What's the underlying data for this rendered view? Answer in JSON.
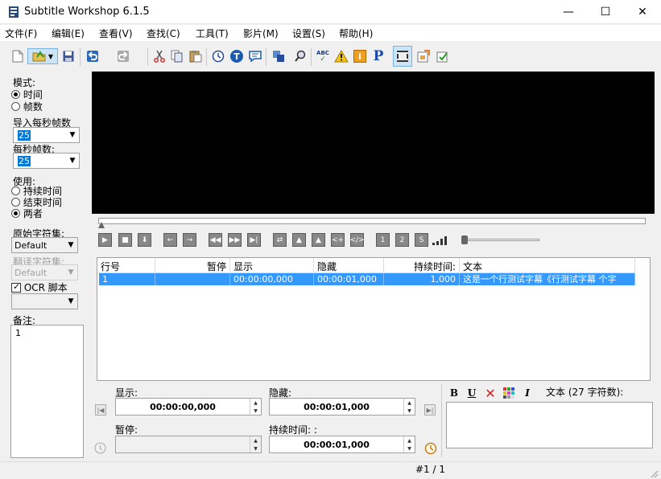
{
  "window": {
    "title": "Subtitle Workshop 6.1.5",
    "minimize": "—",
    "maximize": "☐",
    "close": "✕"
  },
  "menu": [
    "文件(F)",
    "编辑(E)",
    "查看(V)",
    "查找(C)",
    "工具(T)",
    "影片(M)",
    "设置(S)",
    "帮助(H)"
  ],
  "toolbar": {
    "icons": [
      "new-file-icon",
      "open-file-icon",
      "save-icon",
      "undo-icon",
      "redo-icon",
      "cut-icon",
      "copy-icon",
      "paste-icon",
      "timing-icon",
      "text-icon",
      "translation-icon",
      "spellcheck-icon",
      "warning-icon",
      "info-icon",
      "p-icon",
      "video-preview-icon",
      "load-video-icon",
      "check-icon"
    ],
    "text_icon_label": "T",
    "info_icon_label": "i",
    "p_icon_label": "P",
    "spell_label": "ABC"
  },
  "left_panel": {
    "mode_label": "模式:",
    "mode_time": "时间",
    "mode_frames": "帧数",
    "import_fps_label": "导入每秒帧数",
    "import_fps_value": "25",
    "fps_label": "每秒帧数:",
    "fps_value": "25",
    "apply_label": "使用:",
    "apply_duration": "持续时间",
    "apply_end": "结束时间",
    "apply_both": "两者",
    "orig_charset_label": "原始字符集:",
    "orig_charset_value": "Default",
    "trans_charset_label": "翻译字符集:",
    "trans_charset_value": "Default",
    "ocr_label": "OCR 脚本",
    "ocr_value": "",
    "notes_label": "备注:",
    "notes_value": "1"
  },
  "playback": {
    "buttons": [
      "play-icon",
      "stop-icon",
      "pause-icon",
      "back-icon",
      "forward-icon",
      "rewind-icon",
      "fast-forward-icon",
      "frame-icon",
      "loop-icon",
      "set-start-icon",
      "set-end-icon",
      "shift-left-icon",
      "shift-right-icon",
      "one-icon",
      "two-icon",
      "s-icon"
    ],
    "one_label": "1",
    "two_label": "2",
    "s_label": "S"
  },
  "grid": {
    "columns": [
      "行号",
      "暂停",
      "显示",
      "隐藏",
      "持续时间:",
      "文本"
    ],
    "rows": [
      {
        "num": "1",
        "pause": "",
        "show": "00:00:00,000",
        "hide": "00:00:01,000",
        "duration": "1,000",
        "text": "这是一个行测试字幕《行测试字幕 个字"
      }
    ]
  },
  "editor": {
    "show_label": "显示:",
    "show_value": "00:00:00,000",
    "hide_label": "隐藏:",
    "hide_value": "00:00:01,000",
    "pause_label": "暂停:",
    "pause_value": "",
    "duration_label": "持续时间: :",
    "duration_value": "00:00:01,000",
    "bold_label": "B",
    "underline_label": "U",
    "italic_label": "I",
    "text_header": "文本 (27 字符数):",
    "text_value": ""
  },
  "status": {
    "position": "#1 / 1"
  }
}
